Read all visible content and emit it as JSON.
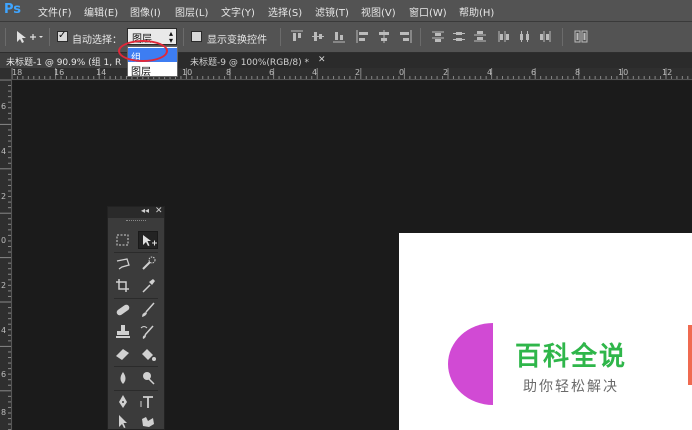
{
  "app": {
    "logo": "Ps"
  },
  "menu": [
    "文件(F)",
    "编辑(E)",
    "图像(I)",
    "图层(L)",
    "文字(Y)",
    "选择(S)",
    "滤镜(T)",
    "视图(V)",
    "窗口(W)",
    "帮助(H)"
  ],
  "options": {
    "auto_select_label": "自动选择：",
    "auto_select_checked": true,
    "auto_select_value": "图层",
    "dropdown_options": [
      "组",
      "图层"
    ],
    "dropdown_highlighted": "组",
    "show_transform_label": "显示变换控件",
    "show_transform_checked": false
  },
  "tabs": [
    {
      "title": "未标题-1 @ 90.9% (组 1, R",
      "active": true
    },
    {
      "title": "未标题-9 @ 100%(RGB/8) *",
      "active": false
    }
  ],
  "ruler_h_labels": [
    "18",
    "16",
    "14",
    "12",
    "10",
    "8",
    "6",
    "4",
    "2",
    "0",
    "2",
    "4",
    "6",
    "8",
    "10",
    "12"
  ],
  "ruler_v_labels": [
    "6",
    "4",
    "2",
    "0",
    "2",
    "4",
    "6",
    "8"
  ],
  "document": {
    "watermark_title": "百科全说",
    "watermark_subtitle": "助你轻松解决"
  },
  "tools_panel": {
    "collapse_icon": "double-chevron-left-icon",
    "close_icon": "close-icon",
    "tools": [
      "rect-marquee-icon",
      "move-tool-icon",
      "lasso-icon",
      "quick-select-icon",
      "crop-icon",
      "eyedropper-icon",
      "healing-brush-icon",
      "brush-icon",
      "clone-stamp-icon",
      "history-brush-icon",
      "eraser-icon",
      "paint-bucket-icon",
      "blur-icon",
      "dodge-icon",
      "pen-icon",
      "type-tool-icon",
      "path-select-icon",
      "custom-shape-icon"
    ],
    "active_tool": "move-tool-icon"
  },
  "colors": {
    "chrome": "#535353",
    "workspace": "#1b1b1b",
    "accent_ps": "#3fa5ff",
    "dropdown_highlight": "#3d7df2",
    "annotation_red": "#e0283a",
    "watermark_green": "#2fb64a"
  }
}
